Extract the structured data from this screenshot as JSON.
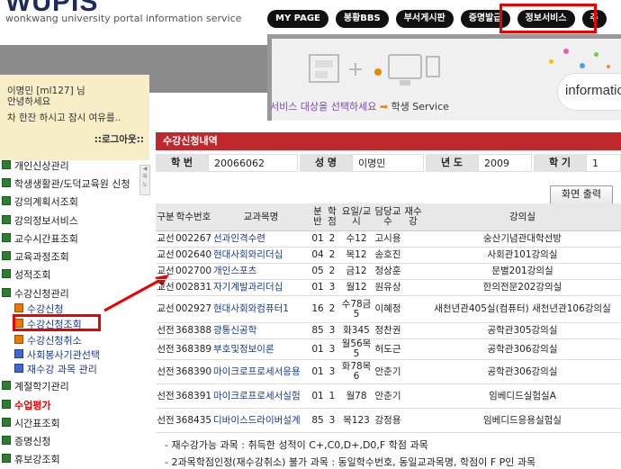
{
  "header": {
    "logo": "WUPIS",
    "subtitle": "wonkwang university portal information service",
    "nav": [
      "MY PAGE",
      "봉황BBS",
      "부서게시판",
      "증명발급",
      "정보서비스",
      "주"
    ]
  },
  "banner": {
    "caption_prefix": "서비스 대상을 선택하세요",
    "caption_arrow": "➡",
    "caption_target": "학생 Service",
    "info_word": "information"
  },
  "user": {
    "line1": "이명민 [ml127] 님",
    "line2": "안녕하세요",
    "line3": "차 한잔 하시고 잠시 여유를..",
    "logout": "::로그아웃::"
  },
  "sidebar": {
    "items": [
      {
        "label": "개인신상관리"
      },
      {
        "label": "학생생활관/도덕교육원 신청"
      },
      {
        "label": "강의계획서조회"
      },
      {
        "label": "강의정보서비스"
      },
      {
        "label": "교수시간표조회"
      },
      {
        "label": "교육과정조회"
      },
      {
        "label": "성적조회"
      },
      {
        "label": "수강신청관리"
      }
    ],
    "sub_items": [
      {
        "label": "수강신청"
      },
      {
        "label": "수강신청조회"
      },
      {
        "label": "수강신청취소"
      },
      {
        "label": "사회봉사기관선택"
      },
      {
        "label": "재수강 과목 관리"
      }
    ],
    "items_after": [
      {
        "label": "계절학기관리"
      },
      {
        "label": "수업평가"
      },
      {
        "label": "시간표조회"
      },
      {
        "label": "증명신청"
      },
      {
        "label": "휴보강조회"
      }
    ]
  },
  "main": {
    "section_title": "수강신청내역",
    "info": {
      "student_no_label": "학 번",
      "student_no": "20066062",
      "name_label": "성 명",
      "name": "이명민",
      "year_label": "년 도",
      "year": "2009",
      "term_label": "학 기",
      "term": "1"
    },
    "print_button": "화면 출력",
    "columns": [
      "구분",
      "학수번호",
      "교과목명",
      "분반",
      "학점",
      "요일/교시",
      "담당교수",
      "재수강",
      "강의실"
    ],
    "rows": [
      [
        "교선",
        "002267",
        "선과인격수련",
        "01",
        "2",
        "수12",
        "고시용",
        "",
        "숭산기념관대학선방"
      ],
      [
        "교선",
        "002640",
        "현대사회와리더십",
        "04",
        "2",
        "목12",
        "송호진",
        "",
        "사회관101강의실"
      ],
      [
        "교선",
        "002700",
        "개인스포츠",
        "05",
        "2",
        "금12",
        "정상훈",
        "",
        "문별201강의실"
      ],
      [
        "교선",
        "002831",
        "자기계발과리더십",
        "01",
        "3",
        "월12",
        "원유상",
        "",
        "한의전문202강의실"
      ],
      [
        "교선",
        "002927",
        "현대사회와컴퓨터1",
        "16",
        "2",
        "수78금5",
        "이혜정",
        "",
        "새천년관405실(컴퓨터) 새천년관106강의실"
      ],
      [
        "선전",
        "368388",
        "광통신공학",
        "85",
        "3",
        "화345",
        "정찬권",
        "",
        "공학관305강의실"
      ],
      [
        "선전",
        "368389",
        "부호및정보이론",
        "01",
        "3",
        "월56목5",
        "허도근",
        "",
        "공학관306강의실"
      ],
      [
        "선전",
        "368390",
        "마이크로프로세서응용",
        "01",
        "3",
        "화78목6",
        "안춘기",
        "",
        "공학관306강의실"
      ],
      [
        "선전",
        "368391",
        "마이크로프로세서실험",
        "01",
        "1",
        "월78",
        "안춘기",
        "",
        "임베디드실험실A"
      ],
      [
        "선전",
        "368435",
        "디바이스드라이버설계",
        "85",
        "3",
        "목123",
        "강정용",
        "",
        "임베디드응용실험실"
      ]
    ],
    "note1": "- 재수강가능 과목 : 취득한 성적이 C+,C0,D+,D0,F 학점 과목",
    "note2": "- 2과목학점인정(재수강취소) 불가 과목 : 동일학수번호, 동일교과목명, 학점이 F P인 과목"
  }
}
